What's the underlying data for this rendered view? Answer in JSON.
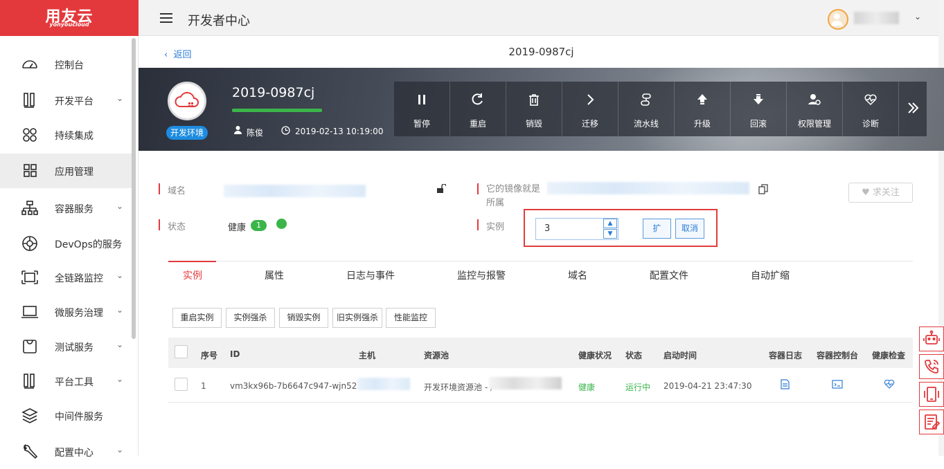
{
  "brand": {
    "name": "用友云",
    "sub": "yonyoucloud"
  },
  "header": {
    "title": "开发者中心"
  },
  "sidebar": {
    "items": [
      {
        "label": "控制台",
        "icon": "dashboard-icon",
        "expandable": false
      },
      {
        "label": "开发平台",
        "icon": "dev-platform-icon",
        "expandable": true
      },
      {
        "label": "持续集成",
        "icon": "integration-icon",
        "expandable": false
      },
      {
        "label": "应用管理",
        "icon": "grid-icon",
        "expandable": false,
        "active": true
      },
      {
        "label": "容器服务",
        "icon": "container-icon",
        "expandable": true
      },
      {
        "label": "DevOps的服务",
        "icon": "devops-icon",
        "expandable": true
      },
      {
        "label": "全链路监控",
        "icon": "monitor-icon",
        "expandable": true
      },
      {
        "label": "微服务治理",
        "icon": "laptop-icon",
        "expandable": true
      },
      {
        "label": "测试服务",
        "icon": "bag-icon",
        "expandable": true
      },
      {
        "label": "平台工具",
        "icon": "tools-icon",
        "expandable": true
      },
      {
        "label": "中间件服务",
        "icon": "layers-icon",
        "expandable": false
      },
      {
        "label": "配置中心",
        "icon": "wrench-icon",
        "expandable": true
      }
    ]
  },
  "subbar": {
    "back": "返回",
    "title": "2019-0987cj"
  },
  "app": {
    "name": "2019-0987cj",
    "env": "开发环境",
    "owner": "陈俊",
    "created": "2019-02-13 10:19:00"
  },
  "actions": [
    {
      "label": "暂停",
      "icon": "pause-icon"
    },
    {
      "label": "重启",
      "icon": "restart-icon"
    },
    {
      "label": "销毁",
      "icon": "trash-icon"
    },
    {
      "label": "迁移",
      "icon": "chevron-right-icon"
    },
    {
      "label": "流水线",
      "icon": "pipeline-icon"
    },
    {
      "label": "升级",
      "icon": "upgrade-icon"
    },
    {
      "label": "回滚",
      "icon": "rollback-icon"
    },
    {
      "label": "权限管理",
      "icon": "permission-icon"
    },
    {
      "label": "诊断",
      "icon": "heartbeat-icon"
    }
  ],
  "info": {
    "domain_label": "域名",
    "image_label": "它的镜像就是所属",
    "status_label": "状态",
    "status_value": "健康",
    "status_count": "1",
    "instance_label": "实例",
    "instance_value": "3",
    "scale_button": "扩",
    "cancel_button": "取消",
    "follow_button": "求关注"
  },
  "tabs": [
    "实例",
    "属性",
    "日志与事件",
    "监控与报警",
    "域名",
    "配置文件",
    "自动扩缩"
  ],
  "ops": [
    "重启实例",
    "实例强杀",
    "销毁实例",
    "旧实例强杀",
    "性能监控"
  ],
  "table": {
    "headers": [
      "序号",
      "ID",
      "主机",
      "资源池",
      "健康状况",
      "状态",
      "启动时间",
      "容器日志",
      "容器控制台",
      "健康检查"
    ],
    "rows": [
      {
        "index": "1",
        "id": "vm3kx96b-7b6647c947-wjn52",
        "pool": "开发环境资源池 - /",
        "health": "健康",
        "state": "运行中",
        "start": "2019-04-21 23:47:30"
      }
    ]
  },
  "colors": {
    "brand": "#e4393c",
    "link": "#2b7bd6",
    "healthy": "#3bb54a"
  }
}
